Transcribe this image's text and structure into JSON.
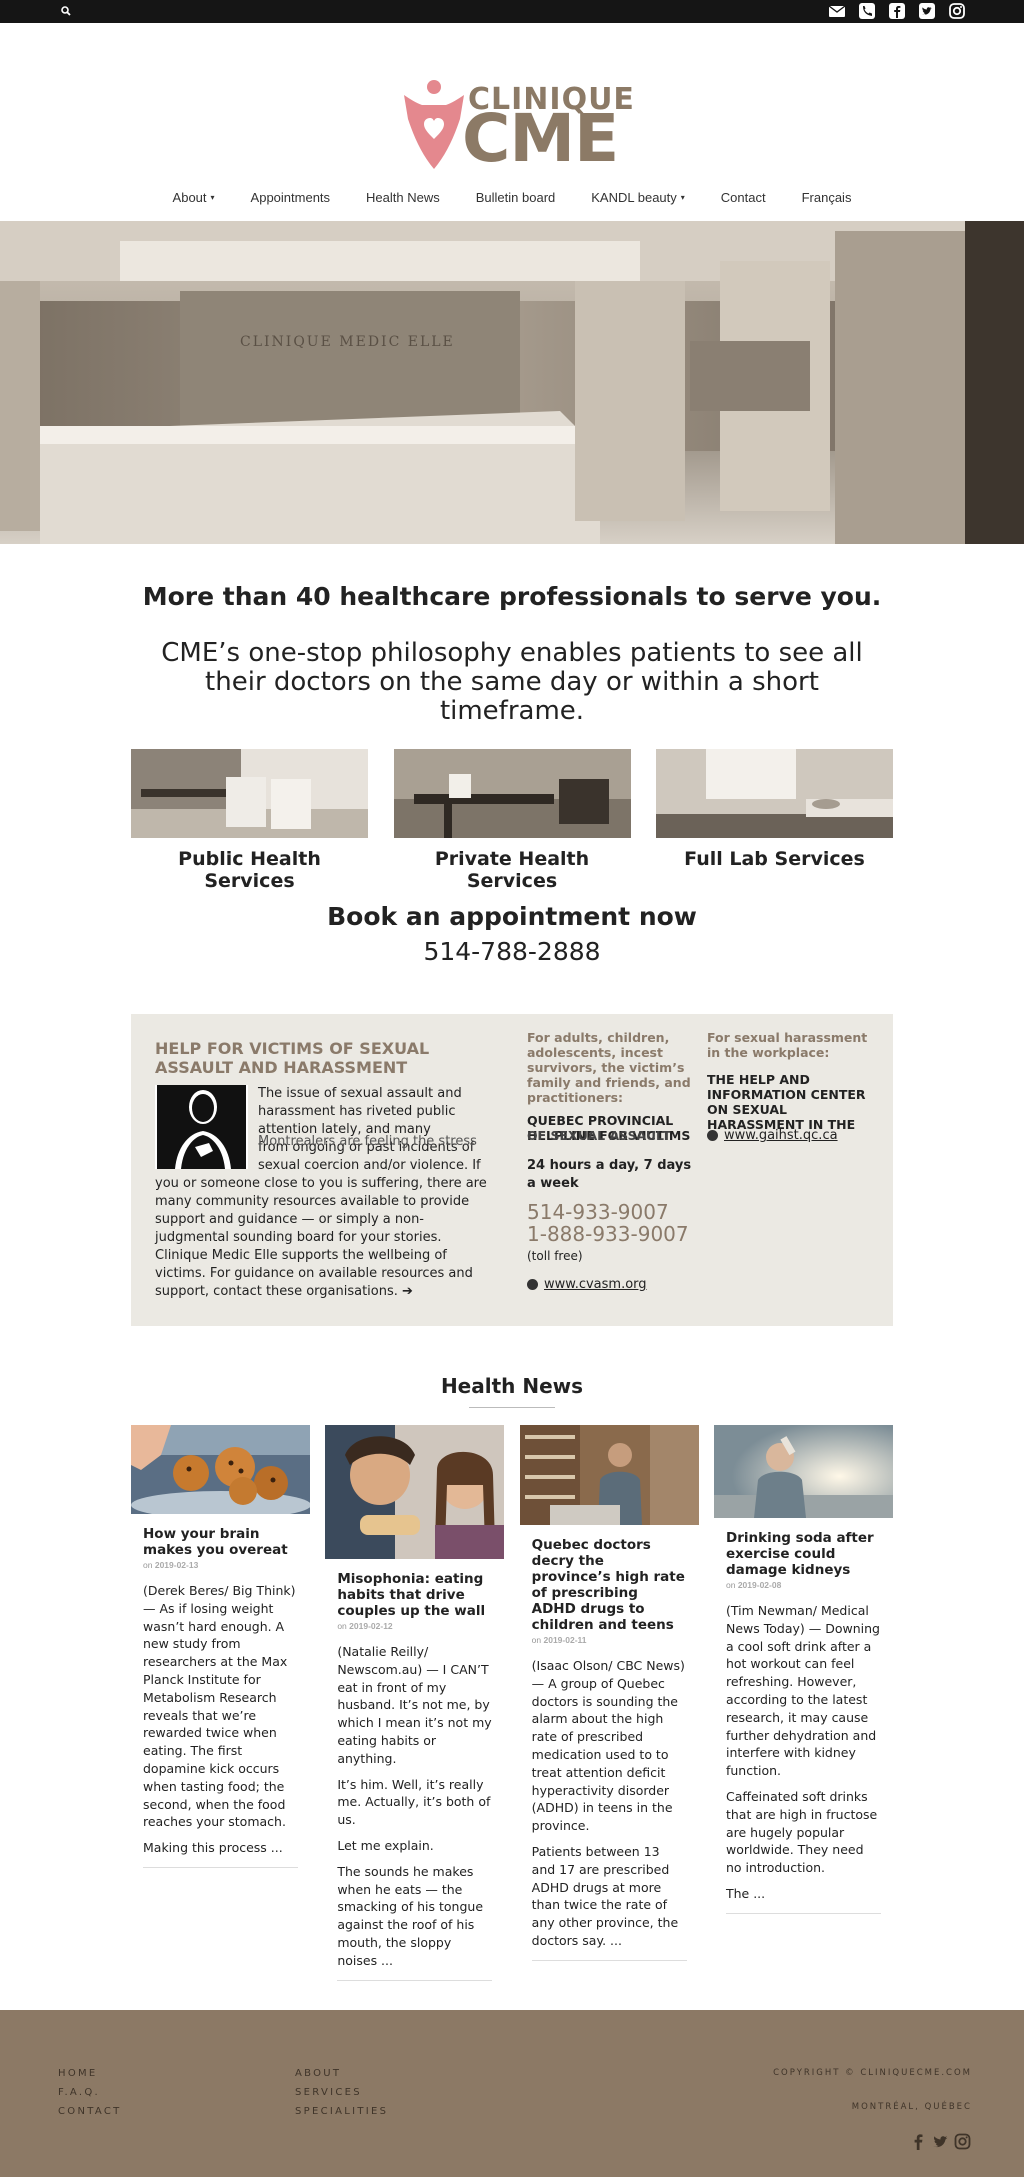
{
  "topbar": {
    "icons": [
      "search-icon",
      "email-icon",
      "phone-icon",
      "facebook-icon",
      "twitter-icon",
      "instagram-icon"
    ]
  },
  "logo": {
    "line1": "CLINIQUE",
    "line2": "CME"
  },
  "nav": [
    {
      "label": "About",
      "caret": true
    },
    {
      "label": "Appointments",
      "caret": false
    },
    {
      "label": "Health News",
      "caret": false
    },
    {
      "label": "Bulletin board",
      "caret": false
    },
    {
      "label": "KANDL beauty",
      "caret": true
    },
    {
      "label": "Contact",
      "caret": false
    },
    {
      "label": "Français",
      "caret": false
    }
  ],
  "hero": {
    "sign": "CLINIQUE MEDIC ELLE"
  },
  "intro": {
    "headline": "More than 40 healthcare professionals to serve you.",
    "philosophy": "CME’s one-stop philosophy enables patients to see all their doctors on the same day or within a short timeframe."
  },
  "services": [
    {
      "label": "Public Health Services"
    },
    {
      "label": "Private Health Services"
    },
    {
      "label": "Full Lab Services"
    }
  ],
  "booking": {
    "title": "Book an appointment now",
    "phone": "514-788-2888"
  },
  "help": {
    "title": "HELP FOR VICTIMS OF SEXUAL ASSAULT AND HARASSMENT",
    "body_top": "The issue of sexual assault and harassment has riveted public attention lately, and many",
    "body_overlap": "Montrealers are feeling the stress",
    "body_rest": "from ongoing or past incidents of sexual coercion and/or violence. If you or someone close to you is suffering, there are many community resources available to provide support and guidance — or simply a non-judgmental sounding board for your stories. Clinique Medic Elle supports the wellbeing of victims. For guidance on available resources and support, contact these organisations.",
    "col2": {
      "intro": "For adults, children, adolescents, incest survivors, the victim’s family and friends, and practitioners:",
      "org": "QUEBEC PROVINCIAL HELPLINE FOR VICTIMS",
      "org_overlap": "OF SEXUAL ASSAULT",
      "hours": "24 hours a day, 7 days a week",
      "phone1": "514-933-9007",
      "phone2": "1-888-933-9007",
      "note": "(toll free)",
      "url": "www.cvasm.org"
    },
    "col3": {
      "intro": "For sexual harassment in the workplace:",
      "org": "THE HELP AND INFORMATION CENTER ON SEXUAL HARASSMENT IN THE WORKPLACE",
      "url": "www.gaihst.qc.ca"
    }
  },
  "news": {
    "title": "Health News",
    "articles": [
      {
        "title": "How your brain makes you overeat",
        "date_prefix": "on",
        "date": "2019-02-13",
        "paras": [
          "(Derek Beres/ Big Think) — As if losing weight wasn’t hard enough. A new study from researchers at the Max Planck Institute for Metabolism Research reveals that we’re rewarded twice when eating. The first dopamine kick occurs when tasting food; the second, when the food reaches your stomach.",
          "Making this process  ..."
        ]
      },
      {
        "title": "Misophonia: eating habits that drive couples up the wall",
        "date_prefix": "on",
        "date": "2019-02-12",
        "paras": [
          "(Natalie Reilly/ Newscom.au) — I CAN’T eat in front of my husband. It’s not me, by which I mean it’s not my eating habits or anything.",
          "It’s him. Well, it’s really me. Actually, it’s both of us.",
          "Let me explain.",
          "The sounds he makes when he eats — the smacking of his tongue against the roof of his mouth, the sloppy noises  ..."
        ]
      },
      {
        "title": "Quebec doctors decry the province’s high rate of prescribing ADHD drugs to children and teens",
        "date_prefix": "on",
        "date": "2019-02-11",
        "paras": [
          "(Isaac Olson/ CBC News) — A group of Quebec doctors is sounding the alarm about the high rate of prescribed medication used to to treat attention deficit hyperactivity disorder (ADHD) in teens in the province.",
          "Patients between 13 and 17 are prescribed ADHD drugs at more than twice the rate of any other province, the doctors say.  ..."
        ]
      },
      {
        "title": "Drinking soda after exercise could damage kidneys",
        "date_prefix": "on",
        "date": "2019-02-08",
        "paras": [
          "(Tim Newman/ Medical News Today) — Downing a cool soft drink after a hot workout can feel refreshing. However, according to the latest research, it may cause further dehydration and interfere with kidney function.",
          "Caffeinated soft drinks that are high in fructose are hugely popular worldwide. They need no introduction.",
          "The  ..."
        ]
      }
    ]
  },
  "footer": {
    "col1": [
      "HOME",
      "F.A.Q.",
      "CONTACT"
    ],
    "col2": [
      "ABOUT",
      "SERVICES",
      "SPECIALITIES"
    ],
    "copyright": "COPYRIGHT © CLINIQUECME.COM",
    "city": "MONTRÉAL, QUÉBEC",
    "icons": [
      "facebook-icon",
      "twitter-icon",
      "instagram-icon"
    ]
  },
  "colors": {
    "brand_brown": "#8c7a66",
    "brand_pink": "#e4888e",
    "footer_bg": "#8c7965",
    "panel_bg": "#ebe9e3",
    "topbar_bg": "#151515"
  }
}
